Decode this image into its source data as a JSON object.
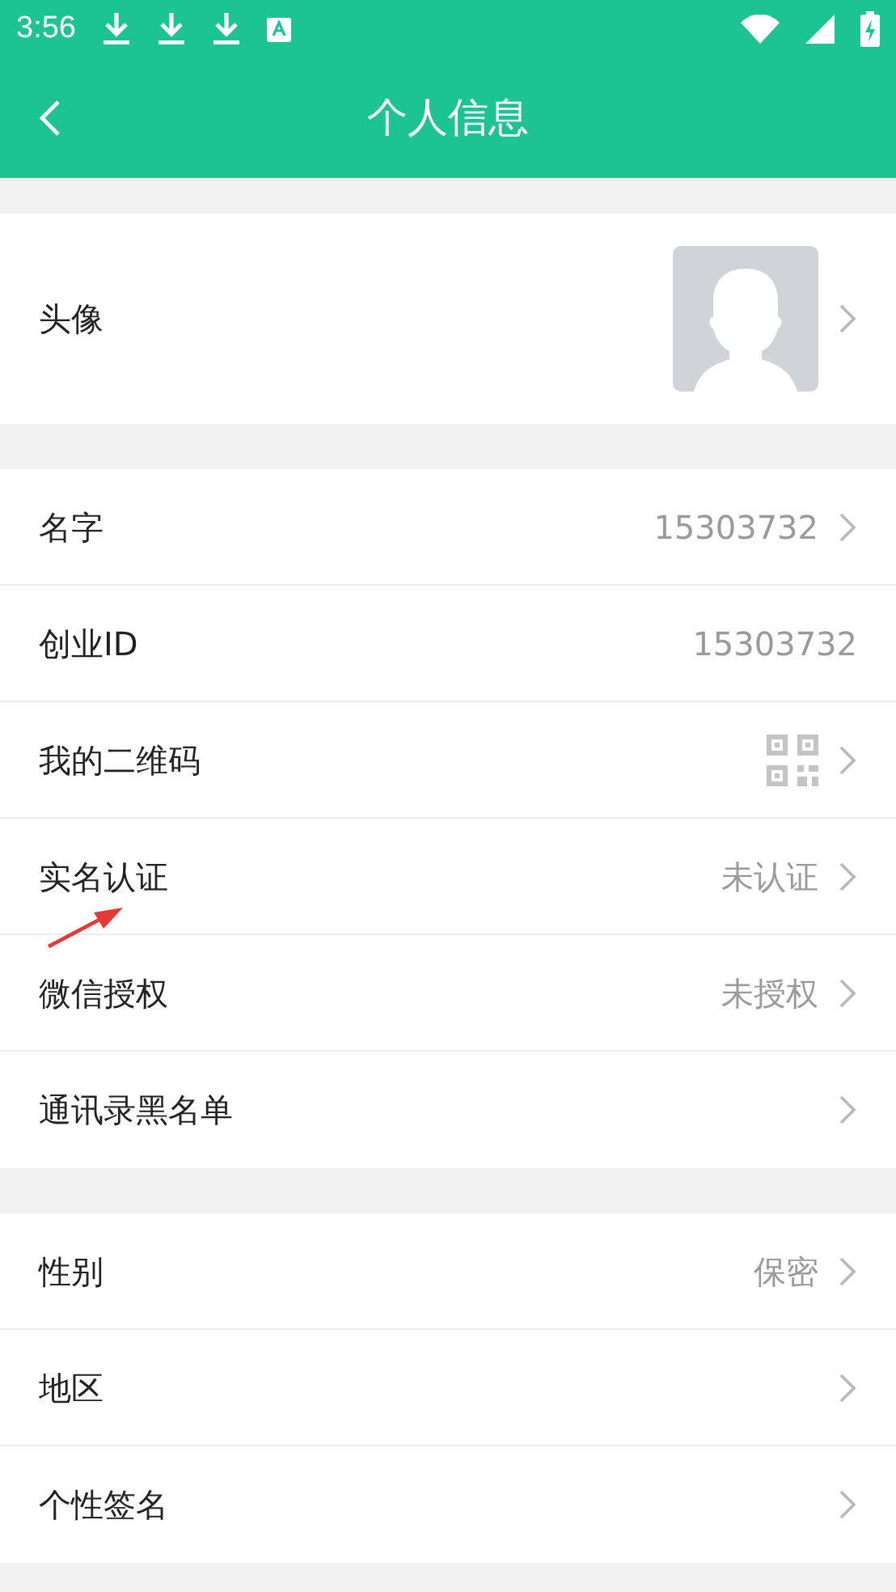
{
  "status_bar": {
    "time": "3:56"
  },
  "header": {
    "title": "个人信息"
  },
  "sections": [
    {
      "rows": [
        {
          "kind": "avatar",
          "label": "头像",
          "chevron": true
        }
      ]
    },
    {
      "rows": [
        {
          "kind": "text",
          "label": "名字",
          "value": "15303732",
          "chevron": true
        },
        {
          "kind": "text",
          "label": "创业ID",
          "value": "15303732",
          "chevron": false
        },
        {
          "kind": "qr",
          "label": "我的二维码",
          "chevron": true
        },
        {
          "kind": "text",
          "label": "实名认证",
          "value": "未认证",
          "chevron": true
        },
        {
          "kind": "text",
          "label": "微信授权",
          "value": "未授权",
          "chevron": true
        },
        {
          "kind": "text",
          "label": "通讯录黑名单",
          "chevron": true
        }
      ]
    },
    {
      "rows": [
        {
          "kind": "text",
          "label": "性别",
          "value": "保密",
          "chevron": true
        },
        {
          "kind": "text",
          "label": "地区",
          "chevron": true
        },
        {
          "kind": "text",
          "label": "个性签名",
          "chevron": true
        }
      ]
    }
  ]
}
